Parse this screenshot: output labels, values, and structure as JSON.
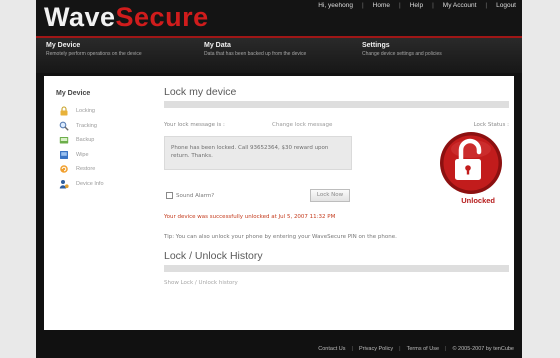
{
  "app": {
    "logo_part1": "Wave",
    "logo_part2": "Secure"
  },
  "topnav": {
    "greeting": "Hi, yeehong",
    "home": "Home",
    "help": "Help",
    "account": "My Account",
    "logout": "Logout"
  },
  "menubar": [
    {
      "title": "My Device",
      "desc": "Remotely perform operations on the device"
    },
    {
      "title": "My Data",
      "desc": "Data that has been backed up from the device"
    },
    {
      "title": "Settings",
      "desc": "Change device settings and policies"
    }
  ],
  "sidebar": {
    "title": "My Device",
    "items": [
      {
        "label": "Locking",
        "icon": "lock-icon"
      },
      {
        "label": "Tracking",
        "icon": "magnifier-icon"
      },
      {
        "label": "Backup",
        "icon": "backup-icon"
      },
      {
        "label": "Wipe",
        "icon": "wipe-icon"
      },
      {
        "label": "Restore",
        "icon": "restore-icon"
      },
      {
        "label": "Device Info",
        "icon": "device-info-icon"
      }
    ]
  },
  "lock_section": {
    "title": "Lock my device",
    "msg_label": "Your lock message is :",
    "change_link": "Change lock message",
    "lock_status_label": "Lock Status :",
    "message": "Phone has been locked. Call 93652364, $30 reward upon return. Thanks.",
    "status": "Unlocked",
    "alarm_label": "Sound Alarm?",
    "lock_button": "Lock Now",
    "success": "Your device was successfully unlocked at Jul 5, 2007 11:32 PM",
    "tip": "Tip: You can also unlock your phone by entering your WaveSecure PIN on the phone."
  },
  "history_section": {
    "title": "Lock / Unlock History",
    "show_link": "Show Lock / Unlock history"
  },
  "footer": {
    "contact": "Contact Us",
    "privacy": "Privacy Policy",
    "terms": "Terms of Use",
    "copyright": "© 2005-2007 by tenCube"
  },
  "colors": {
    "brand_red": "#d01c1c",
    "status_red": "#b61c1c"
  }
}
